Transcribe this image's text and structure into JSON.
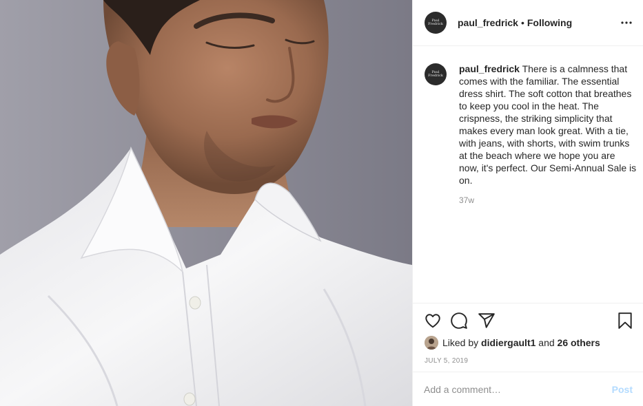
{
  "post": {
    "photo_description_icon": "post-photo",
    "account": {
      "username": "paul_fredrick",
      "separator": "•",
      "follow_status": "Following",
      "avatar_logo_text": [
        "Paul",
        "Fredrick"
      ]
    },
    "caption": {
      "username": "paul_fredrick",
      "text": "There is a calmness that comes with the familiar. The essential dress shirt. The soft cotton that breathes to keep you cool in the heat. The crispness, the striking simplicity that makes every man look great. With a tie, with jeans, with shorts, with swim trunks at the beach where we hope you are now, it's perfect. Our Semi-Annual Sale is on.",
      "time_ago": "37w"
    },
    "actions": {
      "icons": [
        "heart-icon",
        "comment-icon",
        "share-icon",
        "bookmark-icon"
      ],
      "more_icon": "more-options-icon"
    },
    "likes": {
      "prefix": "Liked by",
      "liker": "didiergault1",
      "conjunction": "and",
      "others": "26 others"
    },
    "date": "JULY 5, 2019",
    "comment": {
      "placeholder": "Add a comment…",
      "post_label": "Post"
    }
  },
  "colors": {
    "text": "#262626",
    "muted": "#8e8e8e",
    "post_disabled": "#b3dbff",
    "border": "#efefef"
  }
}
